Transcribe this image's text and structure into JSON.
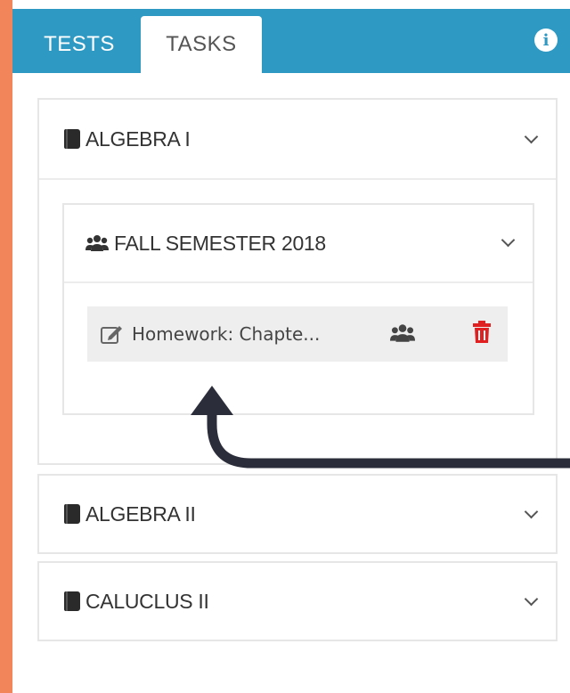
{
  "tabs": {
    "tests_label": "TESTS",
    "tasks_label": "TASKS",
    "active": "TASKS"
  },
  "info_icon": "i",
  "colors": {
    "background_accent": "#f2855a",
    "tab_bar": "#2e9ac4",
    "trash": "#e02020",
    "arrow": "#2b2d3a"
  },
  "courses": [
    {
      "label": "ALGEBRA I",
      "icon": "book-icon",
      "expanded": true,
      "groups": [
        {
          "label": "FALL SEMESTER 2018",
          "icon": "users-icon",
          "expanded": true,
          "tasks": [
            {
              "label": "Homework: Chapte...",
              "icon": "edit-icon",
              "action_icons": [
                "users-icon",
                "trash-icon"
              ]
            }
          ]
        }
      ]
    },
    {
      "label": "ALGEBRA II",
      "icon": "book-icon",
      "expanded": false
    },
    {
      "label": "CALUCLUS II",
      "icon": "book-icon",
      "expanded": false
    }
  ]
}
